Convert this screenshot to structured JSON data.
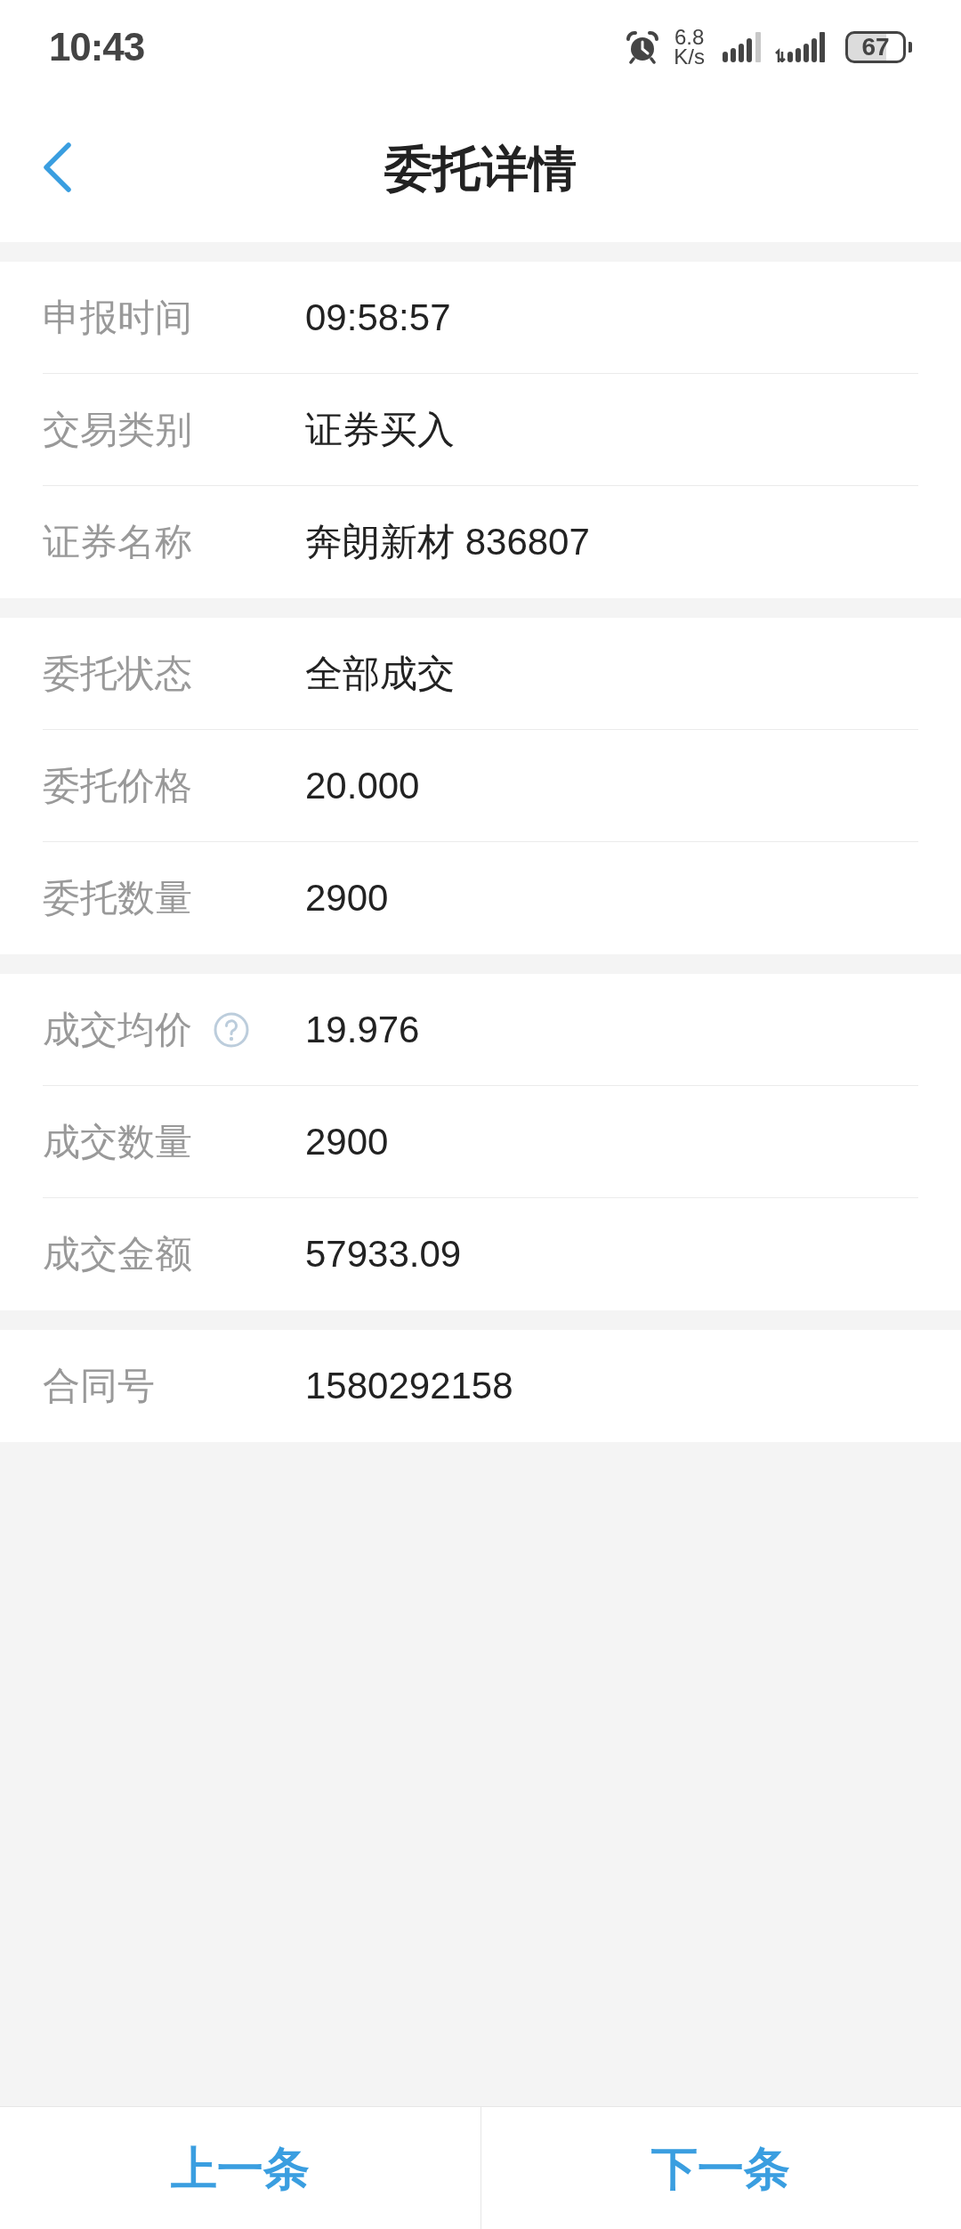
{
  "status_bar": {
    "time": "10:43",
    "network_speed": "6.8",
    "network_speed_unit": "K/s",
    "battery": "67"
  },
  "header": {
    "title": "委托详情"
  },
  "sections": [
    {
      "rows": [
        {
          "label": "申报时间",
          "value": "09:58:57"
        },
        {
          "label": "交易类别",
          "value": "证券买入"
        },
        {
          "label": "证券名称",
          "value": "奔朗新材 836807"
        }
      ]
    },
    {
      "rows": [
        {
          "label": "委托状态",
          "value": "全部成交"
        },
        {
          "label": "委托价格",
          "value": "20.000"
        },
        {
          "label": "委托数量",
          "value": "2900"
        }
      ]
    },
    {
      "rows": [
        {
          "label": "成交均价",
          "value": "19.976",
          "help_icon": true
        },
        {
          "label": "成交数量",
          "value": "2900"
        },
        {
          "label": "成交金额",
          "value": "57933.09"
        }
      ]
    },
    {
      "rows": [
        {
          "label": "合同号",
          "value": "1580292158"
        }
      ]
    }
  ],
  "footer_buttons": [
    {
      "label": "上一条"
    },
    {
      "label": "下一条"
    }
  ]
}
